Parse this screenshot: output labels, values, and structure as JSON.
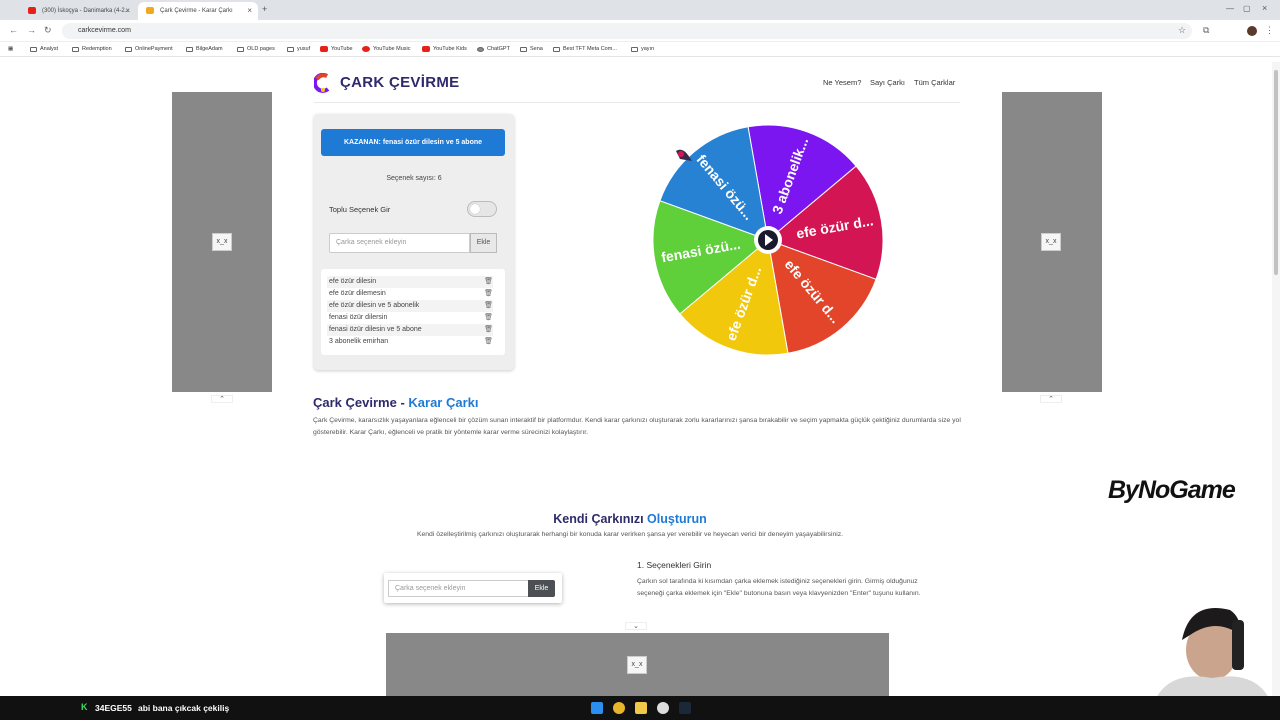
{
  "browser": {
    "tabs": [
      {
        "label": "(300) İskoçya - Danimarka (4-2..."
      },
      {
        "label": "Çark Çevirme - Karar Çarkı"
      }
    ],
    "url": "carkcevirme.com",
    "bookmarks": [
      "Analyst",
      "Redemption",
      "OnlinePayment",
      "BilgeAdam",
      "OLD pages",
      "yusuf",
      "YouTube",
      "YouTube Music",
      "YouTube Kids",
      "ChatGPT",
      "Sena",
      "Best TFT Meta Com...",
      "yayın"
    ]
  },
  "header": {
    "logo": "ÇARK ÇEVİRME",
    "nav": [
      "Ne Yesem?",
      "Sayı Çarkı",
      "Tüm Çarklar"
    ]
  },
  "card": {
    "winner": "KAZANAN: fenasi özür dilesin ve 5 abone",
    "count": "Seçenek sayısı: 6",
    "bulk_label": "Toplu Seçenek Gir",
    "input_placeholder": "Çarka seçenek ekleyin",
    "add_label": "Ekle",
    "options": [
      "efe özür dilesin",
      "efe özür dilemesin",
      "efe özür dilesin ve 5 abonelik",
      "fenasi özür dilersin",
      "fenasi özür dilesin ve 5 abone",
      "3 abonelik emirhan"
    ]
  },
  "wheel": {
    "segments": [
      {
        "label": "3 abonelik...",
        "color": "#7b16f0"
      },
      {
        "label": "efe özür d...",
        "color": "#d41553"
      },
      {
        "label": "efe özür d...",
        "color": "#e2452a"
      },
      {
        "label": "efe özür d...",
        "color": "#f2c80d"
      },
      {
        "label": "fenasi özü...",
        "color": "#5fcf3a"
      },
      {
        "label": "fenasi özü...",
        "color": "#2782d4"
      }
    ]
  },
  "content": {
    "title_a": "Çark Çevirme - ",
    "title_b": "Karar Çarkı",
    "intro": "Çark Çevirme, kararsızlık yaşayanlara eğlenceli bir çözüm sunan interaktif bir platformdur. Kendi karar çarkınızı oluşturarak zorlu kararlarınızı şansa bırakabilir ve seçim yapmakta güçlük çektiğiniz durumlarda size yol gösterebilir. Karar Çarkı, eğlenceli ve pratik bir yöntemle karar verme sürecinizi kolaylaştırır.",
    "h2_a": "Kendi Çarkınızı ",
    "h2_b": "Oluşturun",
    "sub": "Kendi özelleştirilmiş çarkınızı oluşturarak herhangi bir konuda karar verirken şansa yer verebilir ve heyecan verici bir deneyim yaşayabilirsiniz.",
    "demo_placeholder": "Çarka seçenek ekleyin",
    "demo_add": "Ekle",
    "step_title": "1. Seçenekleri Girin",
    "step_text": "Çarkın sol tarafında ki kısımdan çarka eklemek istediğiniz seçenekleri girin. Girmiş olduğunuz seçeneği çarka eklemek için \"Ekle\" butonuna basın veya klavyenizden \"Enter\" tuşunu kullanın."
  },
  "overlay": {
    "brand": "ByNoGame",
    "chat_user": "34EGE55",
    "chat_msg": "abi bana çıkcak çekiliş"
  }
}
